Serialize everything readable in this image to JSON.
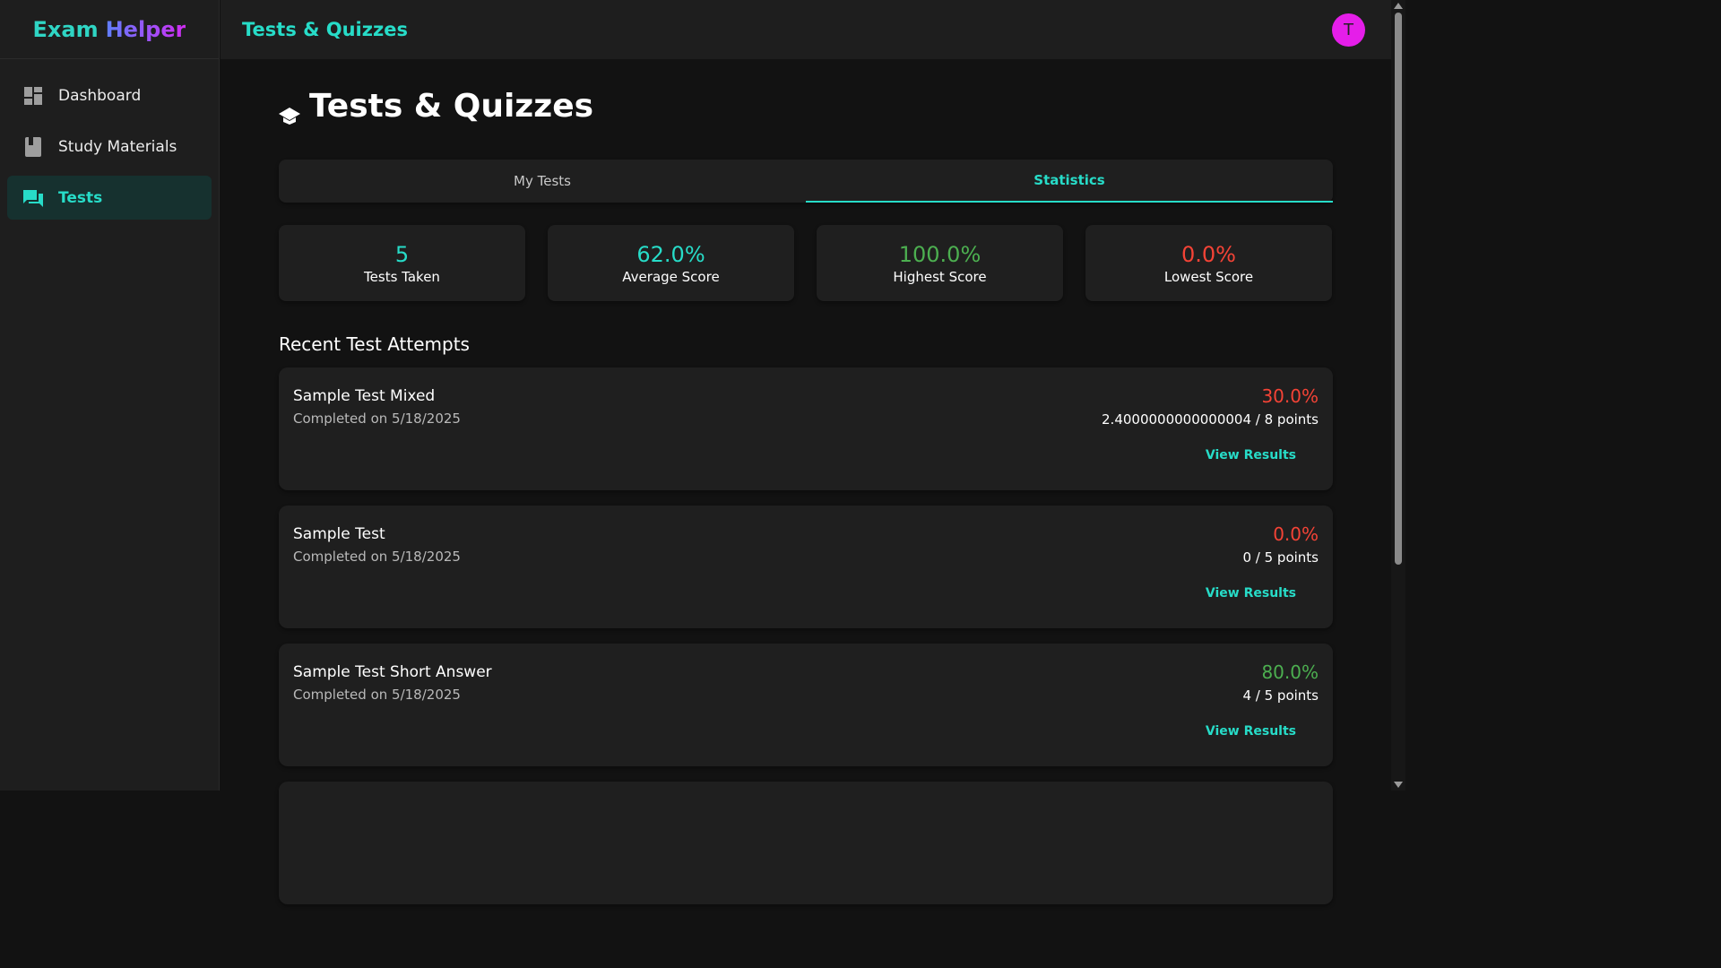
{
  "app": {
    "brand_part1": "Exam",
    "brand_part2": "Helper",
    "avatar_initial": "T"
  },
  "colors": {
    "accent": "#27dcc8",
    "red": "#f44336",
    "green": "#4caf50",
    "avatar": "#e51ee9"
  },
  "sidebar": {
    "items": [
      {
        "label": "Dashboard",
        "icon": "dashboard-icon",
        "active": false
      },
      {
        "label": "Study Materials",
        "icon": "book-icon",
        "active": false
      },
      {
        "label": "Tests",
        "icon": "forum-icon",
        "active": true
      }
    ]
  },
  "header": {
    "title": "Tests & Quizzes"
  },
  "page": {
    "heading": "Tests & Quizzes",
    "heading_icon": "graduation-cap-icon",
    "tabs": [
      {
        "label": "My Tests",
        "active": false
      },
      {
        "label": "Statistics",
        "active": true
      }
    ]
  },
  "stats": [
    {
      "value": "5",
      "label": "Tests Taken",
      "color": "#27dcc8"
    },
    {
      "value": "62.0%",
      "label": "Average Score",
      "color": "#27dcc8"
    },
    {
      "value": "100.0%",
      "label": "Highest Score",
      "color": "#4caf50"
    },
    {
      "value": "0.0%",
      "label": "Lowest Score",
      "color": "#f44336"
    }
  ],
  "recent": {
    "title": "Recent Test Attempts",
    "attempts": [
      {
        "name": "Sample Test Mixed",
        "date": "Completed on 5/18/2025",
        "score": "30.0%",
        "score_color": "#f44336",
        "points": "2.4000000000000004 / 8 points",
        "action": "View Results"
      },
      {
        "name": "Sample Test",
        "date": "Completed on 5/18/2025",
        "score": "0.0%",
        "score_color": "#f44336",
        "points": "0 / 5 points",
        "action": "View Results"
      },
      {
        "name": "Sample Test Short Answer",
        "date": "Completed on 5/18/2025",
        "score": "80.0%",
        "score_color": "#4caf50",
        "points": "4 / 5 points",
        "action": "View Results"
      }
    ]
  }
}
